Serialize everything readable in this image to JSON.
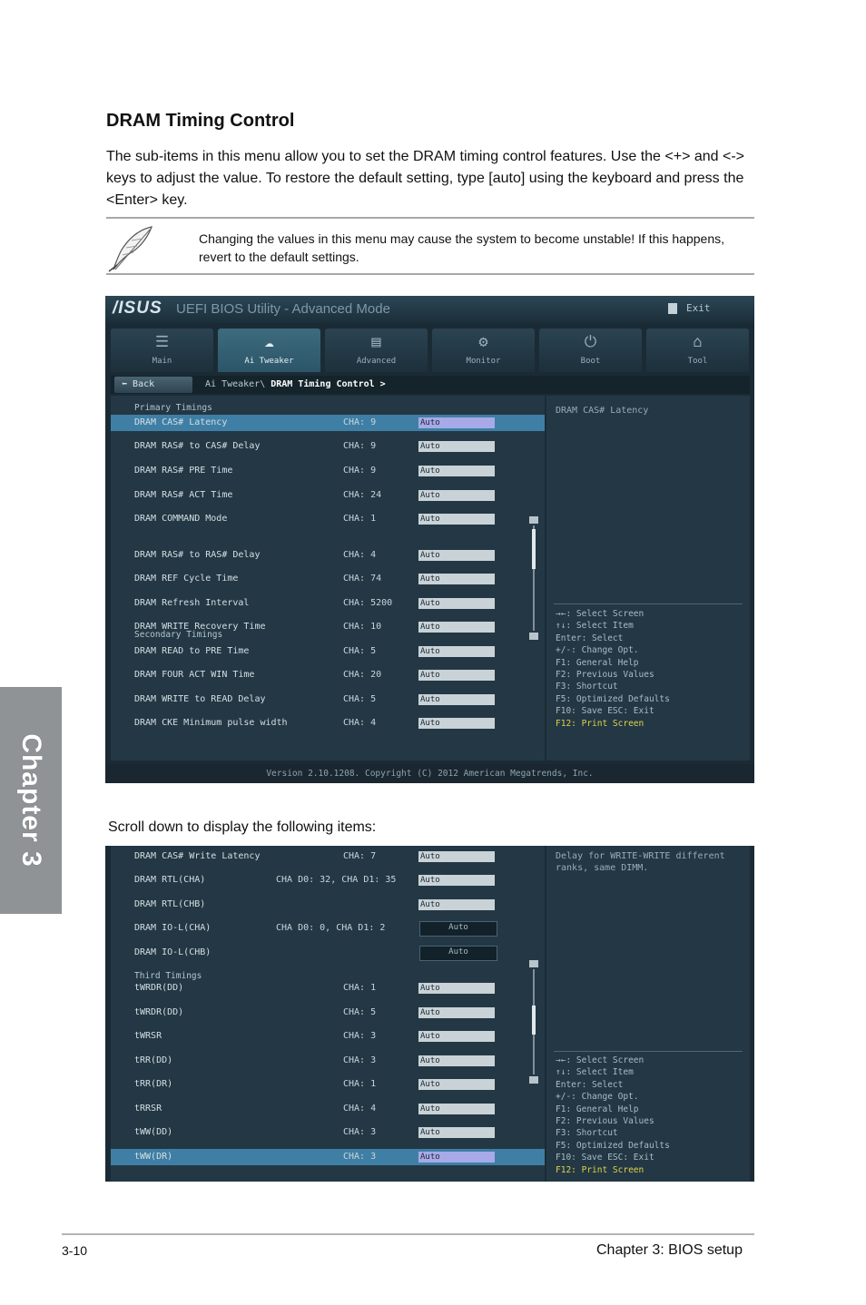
{
  "chapter_tab": "Chapter 3",
  "section_title": "DRAM Timing Control",
  "intro": "The sub-items in this menu allow you to set the DRAM timing control features. Use the <+> and <-> keys to adjust the value. To restore the default setting, type [auto] using the keyboard and press the <Enter> key.",
  "note": "Changing the values in this menu may cause the system to become unstable! If this happens, revert to the default settings.",
  "note_icon": "feather-pen-icon",
  "bios": {
    "logo": "/ISUS",
    "title": "UEFI BIOS Utility - Advanced Mode",
    "exit": "Exit",
    "tabs": [
      {
        "label": "Main",
        "icon": "☰"
      },
      {
        "label": "Ai Tweaker",
        "icon": "☁"
      },
      {
        "label": "Advanced",
        "icon": "▤"
      },
      {
        "label": "Monitor",
        "icon": "⚙"
      },
      {
        "label": "Boot",
        "icon": "⏻"
      },
      {
        "label": "Tool",
        "icon": "⌂"
      }
    ],
    "back": "Back",
    "breadcrumb_prefix": "Ai Tweaker\\ ",
    "breadcrumb_current": "DRAM Timing Control >",
    "status": "Version 2.10.1208. Copyright (C) 2012 American Megatrends, Inc.",
    "keys": [
      "→←: Select Screen",
      "↑↓: Select Item",
      "Enter: Select",
      "+/-: Change Opt.",
      "F1: General Help",
      "F2: Previous Values",
      "F3: Shortcut",
      "F5: Optimized Defaults",
      "F10: Save  ESC: Exit"
    ],
    "key_highlight": "F12: Print Screen"
  },
  "screen1": {
    "help": "DRAM CAS# Latency",
    "groups": [
      "Primary Timings",
      "Secondary Timings"
    ],
    "rows": [
      {
        "label": "DRAM CAS# Latency",
        "current": "CHA:   9",
        "value": "Auto",
        "selected": true
      },
      {
        "label": "DRAM RAS# to CAS# Delay",
        "current": "CHA:   9",
        "value": "Auto"
      },
      {
        "label": "DRAM RAS# PRE Time",
        "current": "CHA:   9",
        "value": "Auto"
      },
      {
        "label": "DRAM RAS# ACT Time",
        "current": "CHA:  24",
        "value": "Auto"
      },
      {
        "label": "DRAM COMMAND Mode",
        "current": "CHA:   1",
        "value": "Auto"
      },
      {
        "label": "DRAM RAS# to RAS# Delay",
        "current": "CHA:   4",
        "value": "Auto"
      },
      {
        "label": "DRAM REF Cycle Time",
        "current": "CHA:  74",
        "value": "Auto"
      },
      {
        "label": "DRAM Refresh Interval",
        "current": "CHA: 5200",
        "value": "Auto"
      },
      {
        "label": "DRAM WRITE Recovery Time",
        "current": "CHA:  10",
        "value": "Auto"
      },
      {
        "label": "DRAM READ to PRE Time",
        "current": "CHA:   5",
        "value": "Auto"
      },
      {
        "label": "DRAM FOUR ACT WIN Time",
        "current": "CHA:  20",
        "value": "Auto"
      },
      {
        "label": "DRAM WRITE to READ Delay",
        "current": "CHA:   5",
        "value": "Auto"
      },
      {
        "label": "DRAM CKE Minimum pulse width",
        "current": "CHA:   4",
        "value": "Auto"
      }
    ]
  },
  "scroll_caption": "Scroll down to display the following items:",
  "screen2": {
    "help": "Delay for WRITE-WRITE different ranks, same DIMM.",
    "group": "Third Timings",
    "rows": [
      {
        "label": "DRAM CAS# Write Latency",
        "current": "CHA:   7",
        "value": "Auto"
      },
      {
        "label": "DRAM RTL(CHA)",
        "current": "CHA D0: 32, CHA D1: 35",
        "value": "Auto",
        "wide": true
      },
      {
        "label": "DRAM RTL(CHB)",
        "current": "",
        "value": "Auto"
      },
      {
        "label": "DRAM IO-L(CHA)",
        "current": "CHA D0:  0, CHA D1:  2",
        "value": "Auto",
        "wide": true,
        "dark": true
      },
      {
        "label": "DRAM IO-L(CHB)",
        "current": "",
        "value": "Auto",
        "dark": true
      },
      {
        "label": "tWRDR(DD)",
        "current": "CHA:   1",
        "value": "Auto"
      },
      {
        "label": "tWRDR(DD)",
        "current": "CHA:   5",
        "value": "Auto"
      },
      {
        "label": "tWRSR",
        "current": "CHA:   3",
        "value": "Auto"
      },
      {
        "label": "tRR(DD)",
        "current": "CHA:   3",
        "value": "Auto"
      },
      {
        "label": "tRR(DR)",
        "current": "CHA:   1",
        "value": "Auto"
      },
      {
        "label": "tRRSR",
        "current": "CHA:   4",
        "value": "Auto"
      },
      {
        "label": "tWW(DD)",
        "current": "CHA:   3",
        "value": "Auto"
      },
      {
        "label": "tWW(DR)",
        "current": "CHA:   3",
        "value": "Auto",
        "selected": true
      }
    ]
  },
  "footer": {
    "page": "3-10",
    "chapter": "Chapter 3: BIOS setup"
  }
}
